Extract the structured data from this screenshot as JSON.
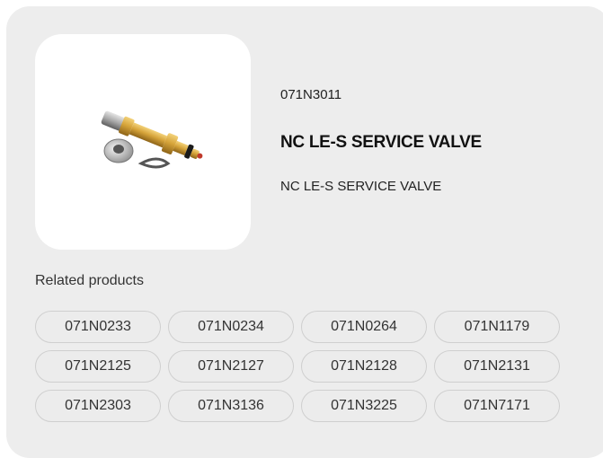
{
  "product": {
    "code": "071N3011",
    "title": "NC LE-S SERVICE VALVE",
    "description": "NC LE-S SERVICE VALVE",
    "image_icon": "service-valve-product-image"
  },
  "related": {
    "heading": "Related products",
    "items": [
      "071N0233",
      "071N0234",
      "071N0264",
      "071N1179",
      "071N2125",
      "071N2127",
      "071N2128",
      "071N2131",
      "071N2303",
      "071N3136",
      "071N3225",
      "071N7171"
    ]
  },
  "colors": {
    "card_background": "#ededed",
    "chip_border": "#cfcfcf",
    "brass": "#c99a2e"
  }
}
